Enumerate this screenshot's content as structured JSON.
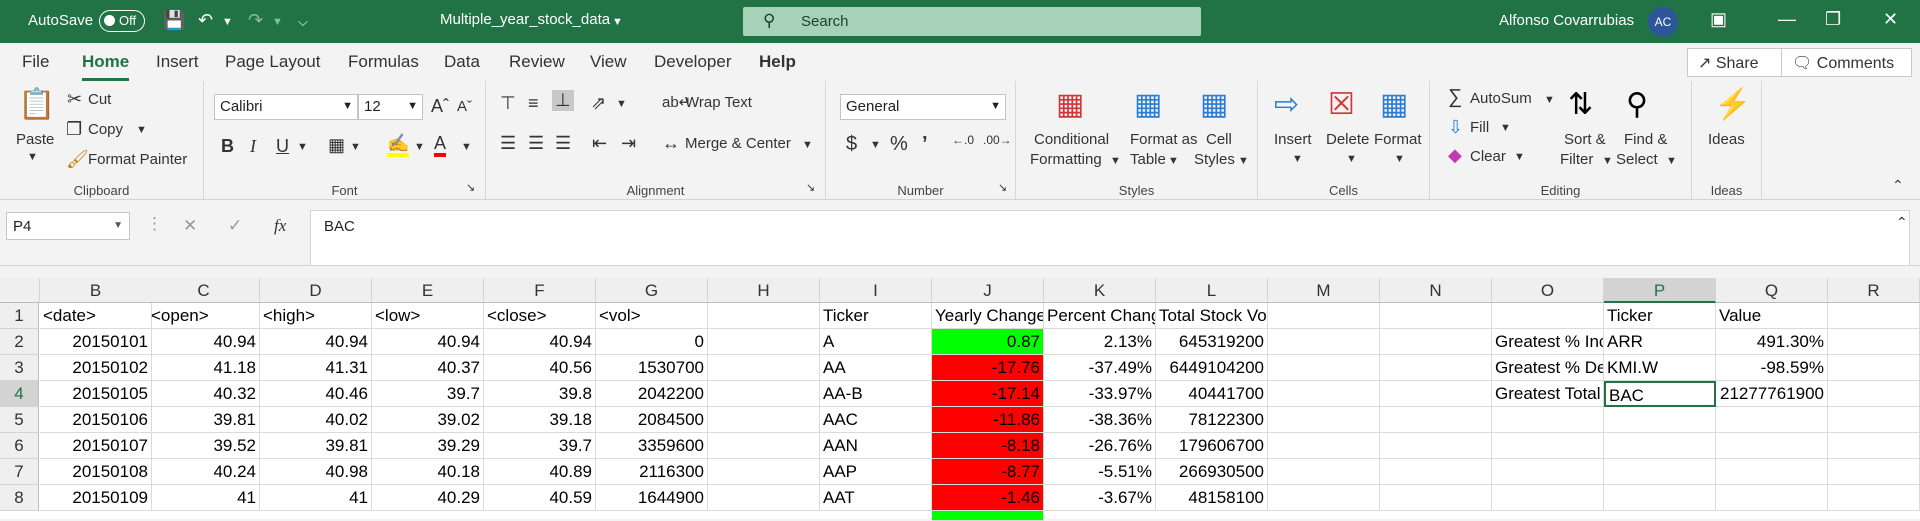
{
  "titlebar": {
    "autosave_label": "AutoSave",
    "autosave_state": "Off",
    "document_name": "Multiple_year_stock_data",
    "search_placeholder": "Search",
    "user_name": "Alfonso Covarrubias",
    "user_initials": "AC",
    "accent": "#217346"
  },
  "menu": {
    "tabs": [
      "File",
      "Home",
      "Insert",
      "Page Layout",
      "Formulas",
      "Data",
      "Review",
      "View",
      "Developer",
      "Help"
    ],
    "active": "Home",
    "share_label": "Share",
    "comments_label": "Comments"
  },
  "ribbon": {
    "clipboard": {
      "label": "Clipboard",
      "paste": "Paste",
      "cut": "Cut",
      "copy": "Copy",
      "format_painter": "Format Painter"
    },
    "font": {
      "label": "Font",
      "family": "Calibri",
      "size": "12"
    },
    "alignment": {
      "label": "Alignment",
      "wrap_text": "Wrap Text",
      "merge_center": "Merge & Center"
    },
    "number": {
      "label": "Number",
      "format": "General"
    },
    "styles": {
      "label": "Styles",
      "conditional": "Conditional",
      "conditional2": "Formatting",
      "format_table": "Format as",
      "format_table2": "Table",
      "cell_styles": "Cell",
      "cell_styles2": "Styles"
    },
    "cells": {
      "label": "Cells",
      "insert": "Insert",
      "delete": "Delete",
      "format": "Format"
    },
    "editing": {
      "label": "Editing",
      "autosum": "AutoSum",
      "fill": "Fill",
      "clear": "Clear",
      "sort": "Sort &",
      "sort2": "Filter",
      "find": "Find &",
      "find2": "Select"
    },
    "ideas": {
      "label": "Ideas",
      "button": "Ideas"
    }
  },
  "formula_bar": {
    "name_box": "P4",
    "formula": "BAC"
  },
  "grid": {
    "columns": [
      "B",
      "C",
      "D",
      "E",
      "F",
      "G",
      "H",
      "I",
      "J",
      "K",
      "L",
      "M",
      "N",
      "O",
      "P",
      "Q",
      "R"
    ],
    "rows": [
      "1",
      "2",
      "3",
      "4",
      "5",
      "6",
      "7",
      "8"
    ],
    "selected_column": "P",
    "selected_row": "4",
    "cells": {
      "r1": [
        "<date>",
        "<open>",
        "<high>",
        "<low>",
        "<close>",
        "<vol>",
        "",
        "Ticker",
        "Yearly Change",
        "Percent Change",
        "Total Stock Volume",
        "",
        "",
        "",
        "Ticker",
        "Value",
        ""
      ],
      "r2": [
        "20150101",
        "40.94",
        "40.94",
        "40.94",
        "40.94",
        "0",
        "",
        "A",
        "0.87",
        "2.13%",
        "645319200",
        "",
        "",
        "Greatest % Increase",
        "ARR",
        "491.30%",
        ""
      ],
      "r3": [
        "20150102",
        "41.18",
        "41.31",
        "40.37",
        "40.56",
        "1530700",
        "",
        "AA",
        "-17.76",
        "-37.49%",
        "6449104200",
        "",
        "",
        "Greatest % Decrease",
        "KMI.W",
        "-98.59%",
        ""
      ],
      "r4": [
        "20150105",
        "40.32",
        "40.46",
        "39.7",
        "39.8",
        "2042200",
        "",
        "AA-B",
        "-17.14",
        "-33.97%",
        "40441700",
        "",
        "",
        "Greatest Total Volume",
        "BAC",
        "21277761900",
        ""
      ],
      "r5": [
        "20150106",
        "39.81",
        "40.02",
        "39.02",
        "39.18",
        "2084500",
        "",
        "AAC",
        "-11.86",
        "-38.36%",
        "78122300",
        "",
        "",
        "",
        "",
        "",
        ""
      ],
      "r6": [
        "20150107",
        "39.52",
        "39.81",
        "39.29",
        "39.7",
        "3359600",
        "",
        "AAN",
        "-8.18",
        "-26.76%",
        "179606700",
        "",
        "",
        "",
        "",
        "",
        ""
      ],
      "r7": [
        "20150108",
        "40.24",
        "40.98",
        "40.18",
        "40.89",
        "2116300",
        "",
        "AAP",
        "-8.77",
        "-5.51%",
        "266930500",
        "",
        "",
        "",
        "",
        "",
        ""
      ],
      "r8": [
        "20150109",
        "41",
        "41",
        "40.29",
        "40.59",
        "1644900",
        "",
        "AAT",
        "-1.46",
        "-3.67%",
        "48158100",
        "",
        "",
        "",
        "",
        "",
        ""
      ]
    },
    "fill_colors": {
      "positive": "#00ff00",
      "negative": "#ff0000"
    }
  }
}
